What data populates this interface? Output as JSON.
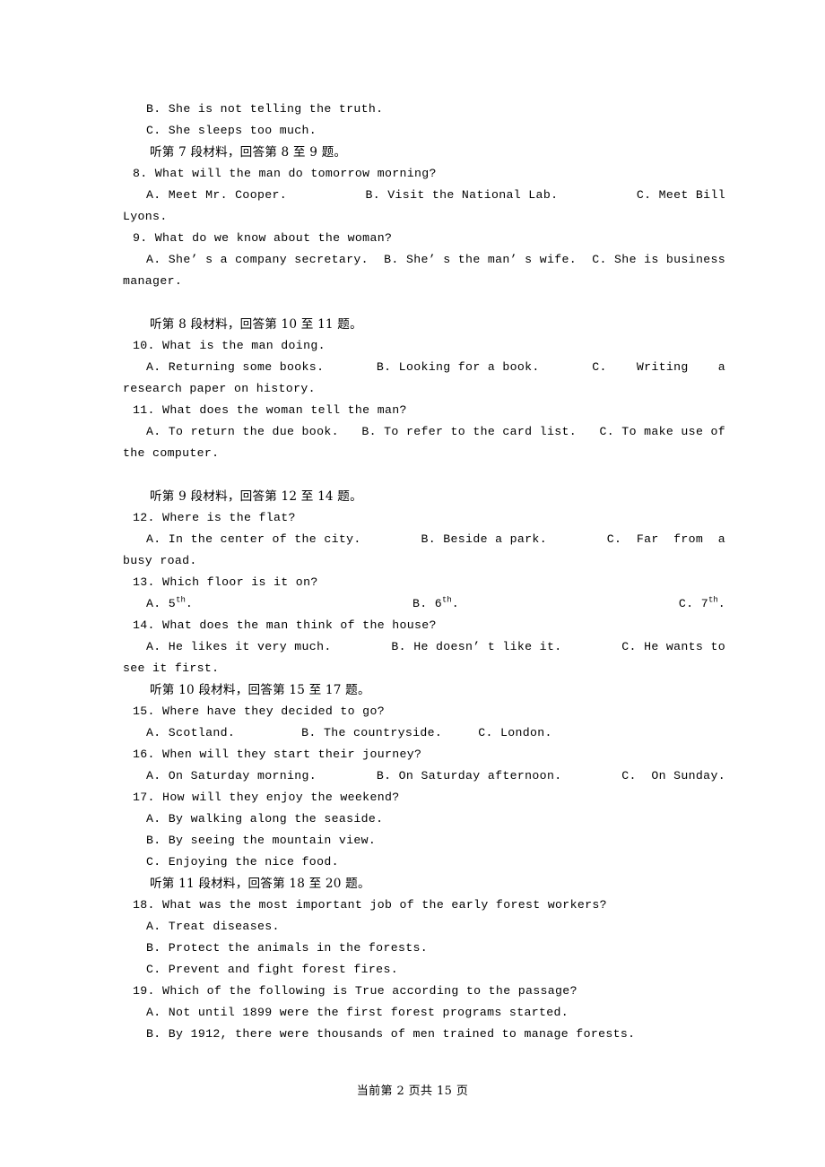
{
  "document": {
    "type": "exam-paper",
    "subject": "English listening comprehension",
    "page_number": 2,
    "total_pages": 15,
    "footer_text": "当前第 2 页共 15 页"
  },
  "lines": {
    "l01_optB_q7": "B. She is not telling the truth.",
    "l02_optC_q7": "C. She sleeps too much.",
    "l03_cn_m7": "听第 7 段材料，回答第 8 至 9 题。",
    "l04_q8": "8. What will the man do tomorrow morning?",
    "l05_q8_a": "A. Meet Mr. Cooper.",
    "l05_q8_b": "B. Visit the National Lab.",
    "l05_q8_c": "C. Meet Bill",
    "l06_q8_wrap": "Lyons.",
    "l07_q9": "9. What do we know about the woman?",
    "l08_q9_a": "A. She’ s a company secretary.",
    "l08_q9_b": "B. She’ s the man’ s wife.",
    "l08_q9_c": "C. She is business",
    "l09_q9_wrap": "manager.",
    "l10_cn_m8": "听第 8 段材料，回答第 10 至 11 题。",
    "l11_q10": "10. What is the man doing.",
    "l12_q10_a": "A. Returning some books.",
    "l12_q10_b": "B. Looking for a book.",
    "l12_q10_c": "C.    Writing    a",
    "l13_q10_wrap": "research paper on history.",
    "l14_q11": "11. What does the woman tell the man?",
    "l15_q11_a": "A. To return the due book.",
    "l15_q11_b": "B. To refer to the card list.",
    "l15_q11_c": "C. To make use of",
    "l16_q11_wrap": "the computer.",
    "l17_cn_m9": "听第 9 段材料，回答第 12 至 14 题。",
    "l18_q12": "12. Where is the flat?",
    "l19_q12_a": "A. In the center of the city.",
    "l19_q12_b": "B. Beside a park.",
    "l19_q12_c": "C.  Far  from  a",
    "l20_q12_wrap": "busy road.",
    "l21_q13": "13. Which floor is it on?",
    "l22_q13_a_pre": "A. 5",
    "l22_q13_a_sup": "th",
    "l22_q13_a_post": ".",
    "l22_q13_b_pre": "B. 6",
    "l22_q13_b_sup": "th",
    "l22_q13_b_post": ".",
    "l22_q13_c_pre": "C. 7",
    "l22_q13_c_sup": "th",
    "l22_q13_c_post": ".",
    "l23_q14": "14. What does the man think of the house?",
    "l24_q14_a": "A. He likes it very much.",
    "l24_q14_b": "B. He doesn’ t like it.",
    "l24_q14_c": "C. He wants to",
    "l25_q14_wrap": "see it first.",
    "l26_cn_m10": "听第 10 段材料，回答第 15 至 17 题。",
    "l27_q15": "15. Where have they decided to go?",
    "l28_q15_a": "A. Scotland.",
    "l28_q15_b": "B. The countryside.",
    "l28_q15_c": "C. London.",
    "l29_q16": "16. When will they start their journey?",
    "l30_q16_a": "A. On Saturday morning.",
    "l30_q16_b": "B. On Saturday afternoon.",
    "l30_q16_c": "C.  On Sunday.",
    "l31_q17": "17. How will they enjoy the weekend?",
    "l32_q17_a": "A. By walking along the seaside.",
    "l33_q17_b": "B. By seeing the mountain view.",
    "l34_q17_c": "C. Enjoying the nice food.",
    "l35_cn_m11": "听第 11 段材料，回答第 18 至 20 题。",
    "l36_q18": "18. What was the most important job of the early forest workers?",
    "l37_q18_a": "A. Treat diseases.",
    "l38_q18_b": "B. Protect the animals in the forests.",
    "l39_q18_c": "C. Prevent and fight forest fires.",
    "l40_q19": "19. Which of the following is True according to the passage?",
    "l41_q19_a": "A. Not until 1899 were the first forest programs started.",
    "l42_q19_b": "B. By 1912, there were thousands of men trained to manage forests."
  }
}
